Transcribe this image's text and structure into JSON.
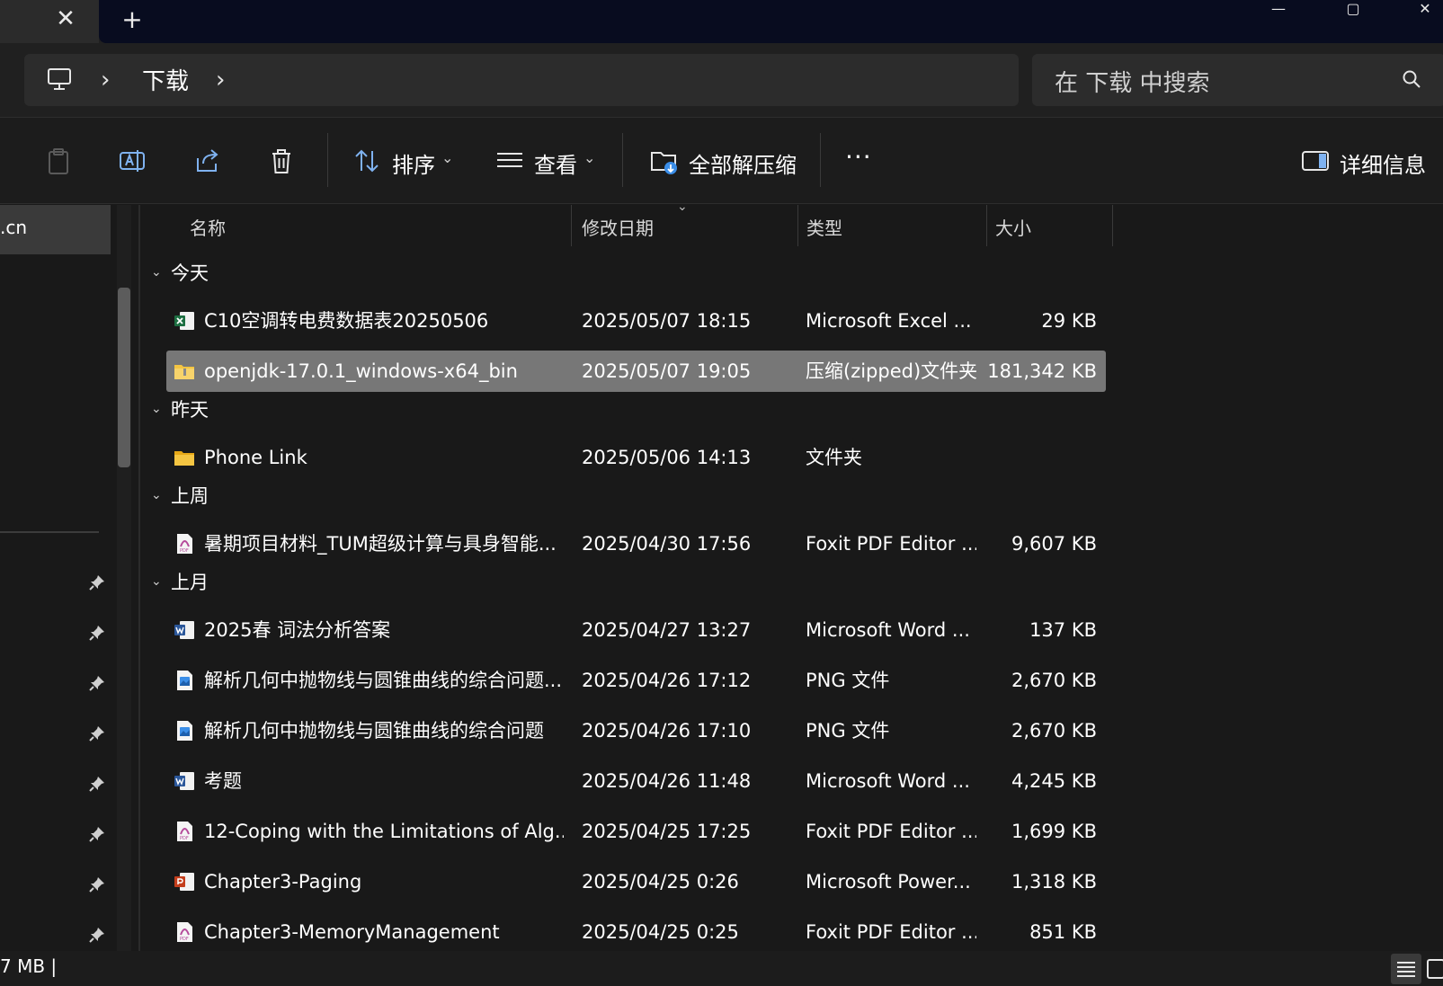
{
  "titlebar": {
    "close_tab_glyph": "✕",
    "new_tab_glyph": "+",
    "minimize_glyph": "—",
    "maximize_glyph": "▢",
    "close_window_glyph": "✕"
  },
  "address": {
    "location_icon": "computer-icon",
    "crumbs": [
      "下载"
    ],
    "separator": "›"
  },
  "search": {
    "placeholder": "在 下载 中搜索",
    "icon": "search-icon"
  },
  "commands": {
    "sort_label": "排序",
    "view_label": "查看",
    "extract_label": "全部解压缩",
    "more_label": "···",
    "details_label": "详细信息"
  },
  "nav": {
    "selected_item": ".cn"
  },
  "columns": {
    "name": "名称",
    "date": "修改日期",
    "type": "类型",
    "size": "大小"
  },
  "groups": [
    {
      "label": "今天",
      "files": [
        {
          "icon": "excel-icon",
          "name": "C10空调转电费数据表20250506",
          "date": "2025/05/07 18:15",
          "type": "Microsoft Excel ...",
          "size": "29 KB",
          "selected": false
        },
        {
          "icon": "zip-folder-icon",
          "name": "openjdk-17.0.1_windows-x64_bin",
          "date": "2025/05/07 19:05",
          "type": "压缩(zipped)文件夹",
          "size": "181,342 KB",
          "selected": true
        }
      ]
    },
    {
      "label": "昨天",
      "files": [
        {
          "icon": "folder-icon",
          "name": "Phone Link",
          "date": "2025/05/06 14:13",
          "type": "文件夹",
          "size": "",
          "selected": false
        }
      ]
    },
    {
      "label": "上周",
      "files": [
        {
          "icon": "pdf-icon",
          "name": "暑期项目材料_TUM超级计算与具身智能...",
          "date": "2025/04/30 17:56",
          "type": "Foxit PDF Editor ...",
          "size": "9,607 KB",
          "selected": false
        }
      ]
    },
    {
      "label": "上月",
      "files": [
        {
          "icon": "word-icon",
          "name": "2025春 词法分析答案",
          "date": "2025/04/27 13:27",
          "type": "Microsoft Word ...",
          "size": "137 KB",
          "selected": false
        },
        {
          "icon": "png-icon",
          "name": "解析几何中抛物线与圆锥曲线的综合问题...",
          "date": "2025/04/26 17:12",
          "type": "PNG 文件",
          "size": "2,670 KB",
          "selected": false
        },
        {
          "icon": "png-icon",
          "name": "解析几何中抛物线与圆锥曲线的综合问题",
          "date": "2025/04/26 17:10",
          "type": "PNG 文件",
          "size": "2,670 KB",
          "selected": false
        },
        {
          "icon": "word-icon",
          "name": "考题",
          "date": "2025/04/26 11:48",
          "type": "Microsoft Word ...",
          "size": "4,245 KB",
          "selected": false
        },
        {
          "icon": "pdf-icon",
          "name": "12-Coping with the Limitations of Alg...",
          "date": "2025/04/25 17:25",
          "type": "Foxit PDF Editor ...",
          "size": "1,699 KB",
          "selected": false
        },
        {
          "icon": "ppt-icon",
          "name": "Chapter3-Paging",
          "date": "2025/04/25 0:26",
          "type": "Microsoft Power...",
          "size": "1,318 KB",
          "selected": false
        },
        {
          "icon": "pdf-icon",
          "name": "Chapter3-MemoryManagement",
          "date": "2025/04/25 0:25",
          "type": "Foxit PDF Editor ...",
          "size": "851 KB",
          "selected": false
        }
      ]
    }
  ],
  "status": {
    "text": "7 MB  |"
  },
  "colors": {
    "background": "#191919",
    "selection": "#777777",
    "excel": "#1d6f42",
    "word": "#2b579a",
    "ppt": "#c43e1c",
    "pdf": "#b4499a",
    "folder": "#f4c542"
  }
}
